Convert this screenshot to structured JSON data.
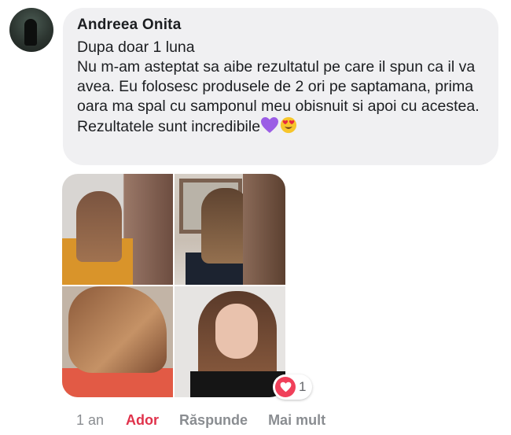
{
  "comment": {
    "author": "Andreea Onita",
    "text": "Dupa doar 1 luna\nNu m-am asteptat sa aibe rezultatul pe care il spun ca il va avea. Eu folosesc produsele de 2 ori pe saptamana, prima oara ma spal cu samponul meu obisnuit si apoi cu acestea. Rezultatele sunt incredibile",
    "emojis": [
      "purple-heart-emoji",
      "heart-eyes-emoji"
    ]
  },
  "photos": [
    {
      "name": "hair-photo-back-before"
    },
    {
      "name": "hair-photo-back-after"
    },
    {
      "name": "hair-photo-side"
    },
    {
      "name": "hair-photo-selfie"
    }
  ],
  "reaction": {
    "icon": "love-reaction-icon",
    "color": "#f0405a",
    "count": "1"
  },
  "actions": {
    "time": "1 an",
    "like_label": "Ador",
    "reply_label": "Răspunde",
    "more_label": "Mai mult",
    "like_color": "#e0324b"
  }
}
